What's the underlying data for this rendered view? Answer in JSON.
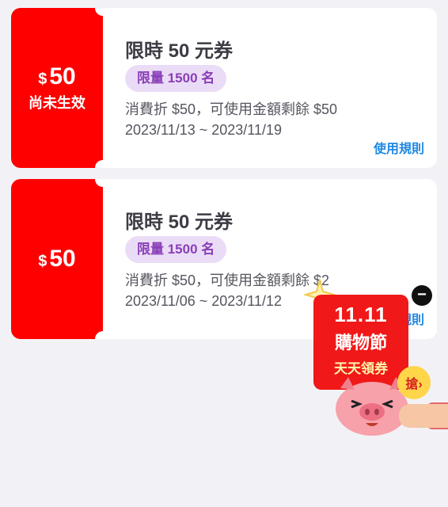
{
  "coupons": [
    {
      "currency": "$",
      "amount": "50",
      "status": "尚未生效",
      "title": "限時 50 元券",
      "badge": "限量 1500 名",
      "description": "消費折 $50，可使用金額剩餘 $50",
      "date_range": "2023/11/13 ~ 2023/11/19",
      "rules_label": "使用規則"
    },
    {
      "currency": "$",
      "amount": "50",
      "status": "",
      "title": "限時 50 元券",
      "badge": "限量 1500 名",
      "description": "消費折 $50，可使用金額剩餘 $2",
      "date_range": "2023/11/06 ~ 2023/11/12",
      "rules_label": "使用規則"
    }
  ],
  "promo": {
    "close_label": "−",
    "date": "11.11",
    "title": "購物節",
    "subtitle": "天天領券",
    "grab_label": "搶›"
  },
  "colors": {
    "brand_red": "#ff0000",
    "badge_bg": "#eadcf6",
    "badge_text": "#8a3fb8",
    "link_blue": "#1e88e5"
  }
}
